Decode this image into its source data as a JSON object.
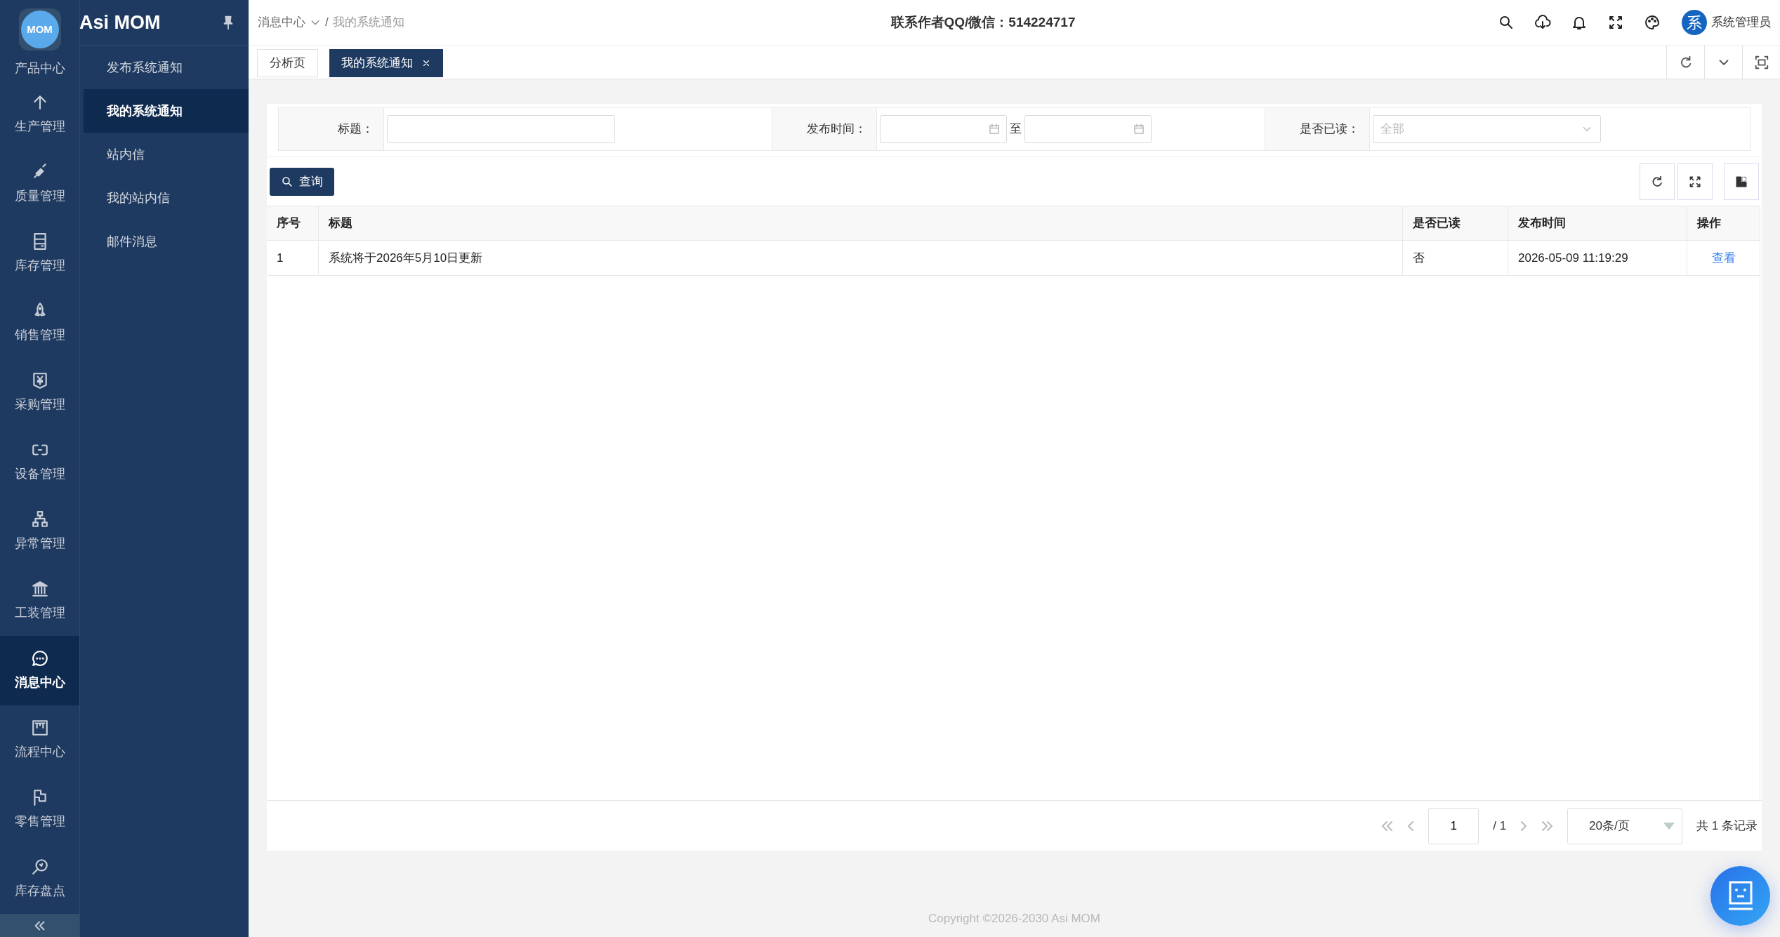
{
  "rail": {
    "logo": "MOM",
    "items": [
      {
        "label": "产品中心",
        "selected": false
      },
      {
        "label": "生产管理",
        "selected": false
      },
      {
        "label": "质量管理",
        "selected": false
      },
      {
        "label": "库存管理",
        "selected": false
      },
      {
        "label": "销售管理",
        "selected": false
      },
      {
        "label": "采购管理",
        "selected": false
      },
      {
        "label": "设备管理",
        "selected": false
      },
      {
        "label": "异常管理",
        "selected": false
      },
      {
        "label": "工装管理",
        "selected": false
      },
      {
        "label": "消息中心",
        "selected": true
      },
      {
        "label": "流程中心",
        "selected": false
      },
      {
        "label": "零售管理",
        "selected": false
      },
      {
        "label": "库存盘点",
        "selected": false
      }
    ]
  },
  "submenu": {
    "title": "Asi MOM",
    "items": [
      {
        "label": "发布系统通知",
        "selected": false
      },
      {
        "label": "我的系统通知",
        "selected": true
      },
      {
        "label": "站内信",
        "selected": false
      },
      {
        "label": "我的站内信",
        "selected": false
      },
      {
        "label": "邮件消息",
        "selected": false
      }
    ]
  },
  "breadcrumb": {
    "items": [
      "消息中心",
      "我的系统通知"
    ],
    "separator": "/"
  },
  "contact": "联系作者QQ/微信：514224717",
  "user": {
    "avatar": "系",
    "name": "系统管理员"
  },
  "tabs": [
    {
      "label": "分析页",
      "selected": false,
      "closable": false
    },
    {
      "label": "我的系统通知",
      "selected": true,
      "closable": true
    }
  ],
  "filters": [
    {
      "kind": "text",
      "label": "标题："
    },
    {
      "kind": "daterange",
      "label": "发布时间：",
      "separator": "至"
    },
    {
      "kind": "select",
      "label": "是否已读：",
      "placeholder": "全部"
    }
  ],
  "query_button": "查询",
  "table": {
    "columns": [
      "序号",
      "标题",
      "是否已读",
      "发布时间",
      "操作"
    ],
    "rows": [
      {
        "cells": [
          "1",
          "系统将于2026年5月10日更新",
          "否",
          "2026-05-09 11:19:29"
        ],
        "action": "查看"
      }
    ]
  },
  "pagination": {
    "page": "1",
    "total_pages": "/ 1",
    "page_size": "20条/页",
    "summary": "共 1 条记录"
  },
  "footer": "Copyright ©2026-2030 Asi MOM"
}
